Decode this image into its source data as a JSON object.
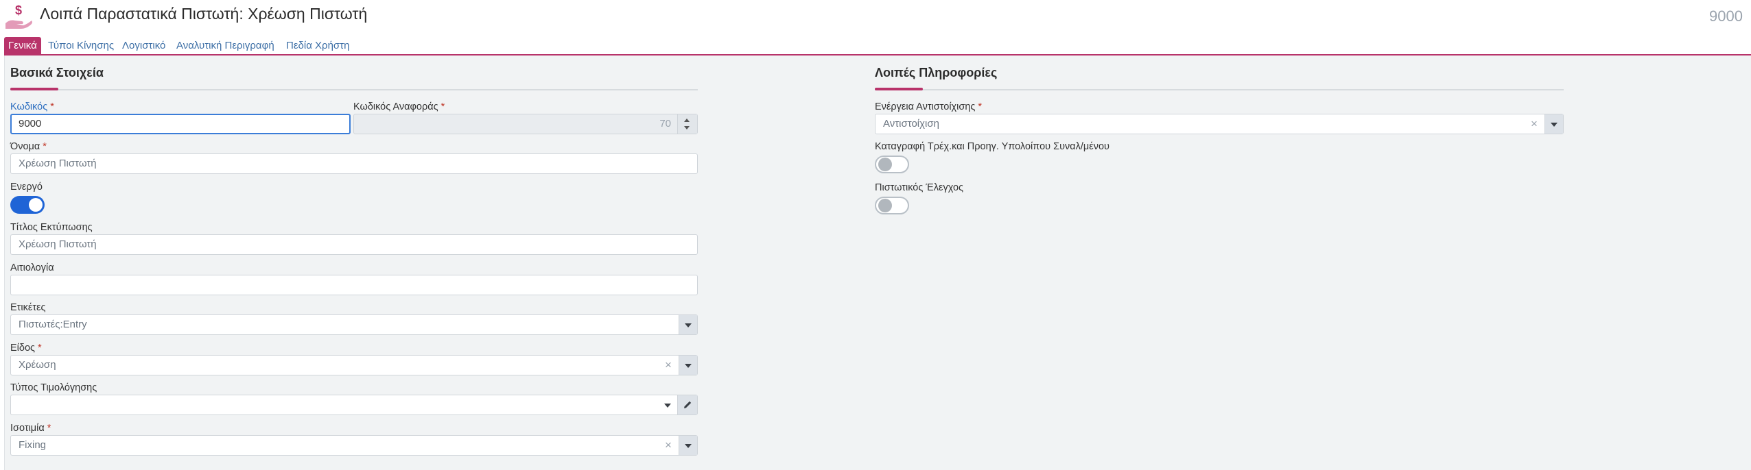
{
  "header": {
    "title": "Λοιπά Παραστατικά Πιστωτή: Χρέωση Πιστωτή",
    "record_number": "9000",
    "icon": "dollar-hand-icon",
    "brand_color": "#b8336a"
  },
  "tabs": [
    {
      "label": "Γενικά",
      "active": true
    },
    {
      "label": "Τύποι Κίνησης",
      "active": false
    },
    {
      "label": "Λογιστικό",
      "active": false
    },
    {
      "label": "Αναλυτική Περιγραφή",
      "active": false
    },
    {
      "label": "Πεδία Χρήστη",
      "active": false
    }
  ],
  "basic": {
    "section_title": "Βασικά Στοιχεία",
    "code": {
      "label": "Κωδικός",
      "required": "*",
      "value": "9000"
    },
    "ref_code": {
      "label": "Κωδικός Αναφοράς",
      "required": "*",
      "value": "70"
    },
    "name": {
      "label": "Όνομα",
      "required": "*",
      "value": "Χρέωση Πιστωτή"
    },
    "active": {
      "label": "Ενεργό",
      "on": true
    },
    "print_title": {
      "label": "Τίτλος Εκτύπωσης",
      "value": "Χρέωση Πιστωτή"
    },
    "reason": {
      "label": "Αιτιολογία",
      "value": ""
    },
    "tags": {
      "label": "Ετικέτες",
      "value": "Πιστωτές:Entry"
    },
    "kind": {
      "label": "Είδος",
      "required": "*",
      "value": "Χρέωση",
      "clear": "×"
    },
    "invoice_type": {
      "label": "Τύπος Τιμολόγησης",
      "value": ""
    },
    "parity": {
      "label": "Ισοτιμία",
      "required": "*",
      "value": "Fixing",
      "clear": "×"
    }
  },
  "other": {
    "section_title": "Λοιπές Πληροφορίες",
    "match_action": {
      "label": "Ενέργεια Αντιστοίχισης",
      "required": "*",
      "value": "Αντιστοίχιση",
      "clear": "×"
    },
    "record_balance": {
      "label": "Καταγραφή Τρέχ.και Προηγ. Υπολοίπου Συναλ/μένου",
      "on": false
    },
    "credit_check": {
      "label": "Πιστωτικός Έλεγχος",
      "on": false
    }
  }
}
